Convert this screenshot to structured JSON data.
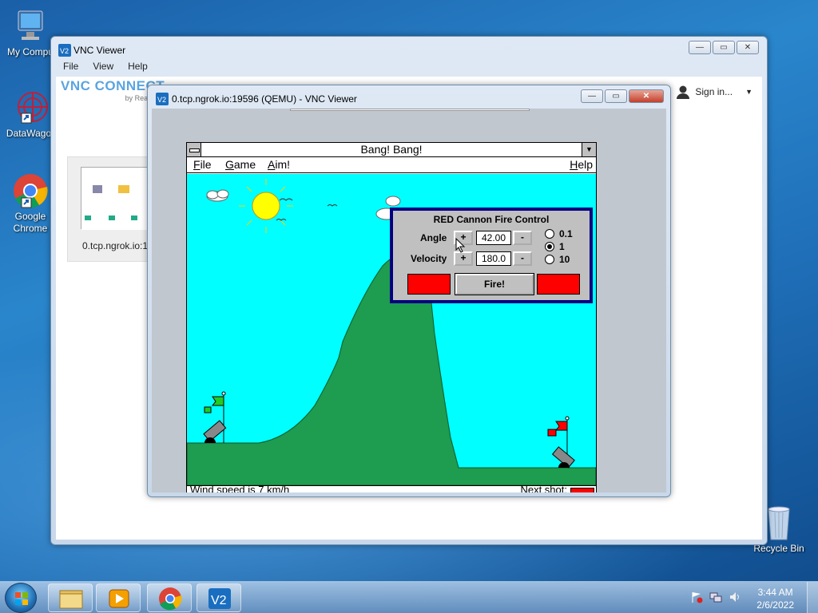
{
  "desktop": {
    "icons": [
      {
        "label": "My Compu"
      },
      {
        "label": "DataWagor"
      },
      {
        "label": "Google Chrome"
      },
      {
        "label": "Recycle Bin"
      }
    ]
  },
  "vnc_viewer": {
    "title": "VNC Viewer",
    "menu": [
      "File",
      "View",
      "Help"
    ],
    "logo": "VNC CONNECT",
    "logo_sub": "by RealVNC",
    "sign_in": "Sign in...",
    "connection_label": "0.tcp.ngrok.io:1"
  },
  "qemu_window": {
    "title": "0.tcp.ngrok.io:19596 (QEMU) - VNC Viewer"
  },
  "game": {
    "title": "Bang! Bang!",
    "menu": {
      "file": "File",
      "game": "Game",
      "aim": "Aim!",
      "help": "Help"
    },
    "status_left": "Wind speed is 7 km/h",
    "status_right": "Next shot:",
    "colors": {
      "sky": "#00ffff",
      "hill": "#1e9c50",
      "sun": "#ffff00",
      "cannon_red": "#ff0000",
      "flag_green": "#22cc22"
    }
  },
  "fire_control": {
    "title": "RED Cannon Fire Control",
    "angle_label": "Angle",
    "angle_value": "42.00",
    "velocity_label": "Velocity",
    "velocity_value": "180.0",
    "plus": "+",
    "minus": "-",
    "increments": [
      "0.1",
      "1",
      "10"
    ],
    "selected_increment": "1",
    "fire_label": "Fire!"
  },
  "taskbar": {
    "time": "3:44 AM",
    "date": "2/6/2022"
  }
}
